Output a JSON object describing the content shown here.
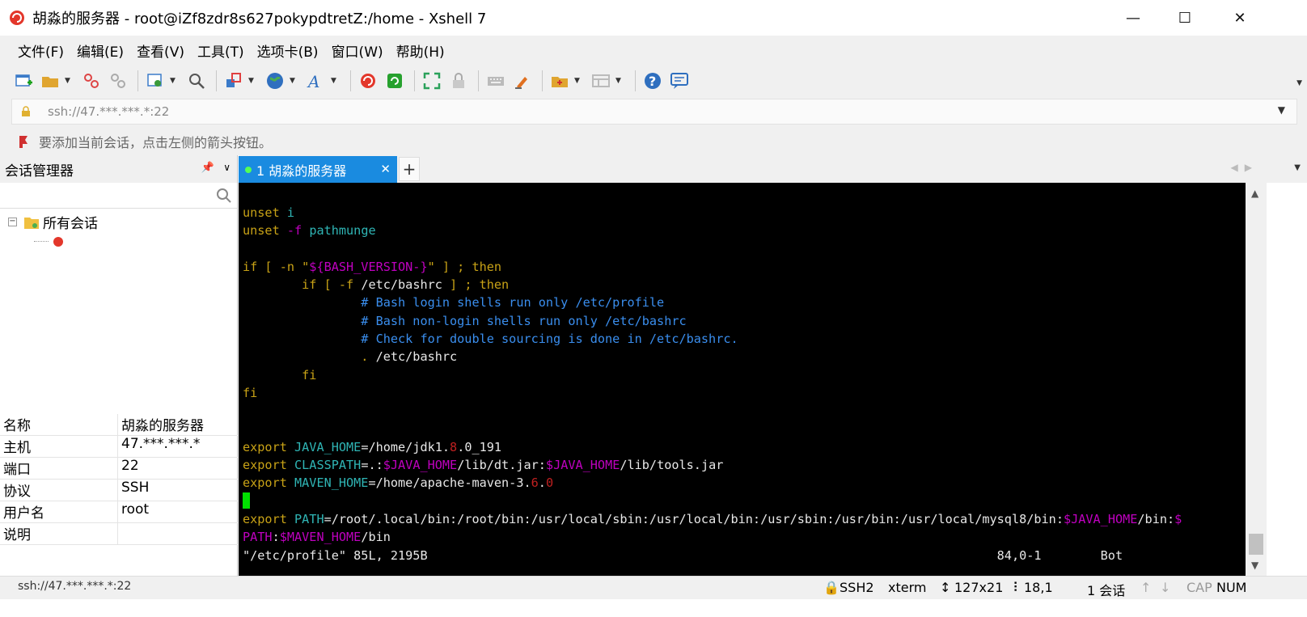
{
  "window": {
    "title": "胡淼的服务器 - root@iZf8zdr8s627pokypdtretZ:/home - Xshell 7",
    "minimize": "—",
    "maximize": "☐",
    "close": "✕"
  },
  "menu": [
    "文件(F)",
    "编辑(E)",
    "查看(V)",
    "工具(T)",
    "选项卡(B)",
    "窗口(W)",
    "帮助(H)"
  ],
  "address": {
    "text": "ssh://47.***.***.*:22"
  },
  "hint": "要添加当前会话，点击左侧的箭头按钮。",
  "session_manager": {
    "title": "会话管理器",
    "search_placeholder": "",
    "tree_root": "所有会话",
    "tree_child": "胡淼的服务器",
    "properties": [
      {
        "key": "名称",
        "value": "胡淼的服务器"
      },
      {
        "key": "主机",
        "value": "47.***.***.*"
      },
      {
        "key": "端口",
        "value": "22"
      },
      {
        "key": "协议",
        "value": "SSH"
      },
      {
        "key": "用户名",
        "value": "root"
      },
      {
        "key": "说明",
        "value": ""
      }
    ]
  },
  "tabs": {
    "active_label": "1 胡淼的服务器",
    "close": "✕",
    "new": "+"
  },
  "terminal": {
    "lines": [
      [
        {
          "t": "unset ",
          "c": "y"
        },
        {
          "t": "i",
          "c": "c"
        }
      ],
      [
        {
          "t": "unset ",
          "c": "y"
        },
        {
          "t": "-f ",
          "c": "m"
        },
        {
          "t": "pathmunge",
          "c": "c"
        }
      ],
      [],
      [
        {
          "t": "if [ -n \"",
          "c": "y"
        },
        {
          "t": "${BASH_VERSION-}",
          "c": "m"
        },
        {
          "t": "\" ] ; then",
          "c": "y"
        }
      ],
      [
        {
          "t": "        if [ -f ",
          "c": "y"
        },
        {
          "t": "/etc/bashrc",
          "c": "w"
        },
        {
          "t": " ] ; then",
          "c": "y"
        }
      ],
      [
        {
          "t": "                # Bash login shells run only /etc/profile",
          "c": "b"
        }
      ],
      [
        {
          "t": "                # Bash non-login shells run only /etc/bashrc",
          "c": "b"
        }
      ],
      [
        {
          "t": "                # Check for double sourcing is done in /etc/bashrc.",
          "c": "b"
        }
      ],
      [
        {
          "t": "                . ",
          "c": "y"
        },
        {
          "t": "/etc/bashrc",
          "c": "w"
        }
      ],
      [
        {
          "t": "        fi",
          "c": "y"
        }
      ],
      [
        {
          "t": "fi",
          "c": "y"
        }
      ],
      [],
      [],
      [
        {
          "t": "export ",
          "c": "y"
        },
        {
          "t": "JAVA_HOME",
          "c": "c"
        },
        {
          "t": "=/home/jdk1.",
          "c": "w"
        },
        {
          "t": "8",
          "c": "r"
        },
        {
          "t": ".0_191",
          "c": "w"
        }
      ],
      [
        {
          "t": "export ",
          "c": "y"
        },
        {
          "t": "CLASSPATH",
          "c": "c"
        },
        {
          "t": "=.:",
          "c": "w"
        },
        {
          "t": "$JAVA_HOME",
          "c": "m"
        },
        {
          "t": "/lib/dt.jar:",
          "c": "w"
        },
        {
          "t": "$JAVA_HOME",
          "c": "m"
        },
        {
          "t": "/lib/tools.jar",
          "c": "w"
        }
      ],
      [
        {
          "t": "export ",
          "c": "y"
        },
        {
          "t": "MAVEN_HOME",
          "c": "c"
        },
        {
          "t": "=/home/apache-maven-3.",
          "c": "w"
        },
        {
          "t": "6",
          "c": "r"
        },
        {
          "t": ".",
          "c": "w"
        },
        {
          "t": "0",
          "c": "r"
        }
      ],
      [
        {
          "t": "CURSOR",
          "c": "cur"
        }
      ],
      [
        {
          "t": "export ",
          "c": "y"
        },
        {
          "t": "PATH",
          "c": "c"
        },
        {
          "t": "=/root/.local/bin:/root/bin:/usr/local/sbin:/usr/local/bin:/usr/sbin:/usr/bin:/usr/local/mysql8/bin:",
          "c": "w"
        },
        {
          "t": "$JAVA_HOME",
          "c": "m"
        },
        {
          "t": "/bin:",
          "c": "w"
        },
        {
          "t": "$",
          "c": "m"
        }
      ],
      [
        {
          "t": "PATH",
          "c": "m"
        },
        {
          "t": ":",
          "c": "w"
        },
        {
          "t": "$MAVEN_HOME",
          "c": "m"
        },
        {
          "t": "/bin",
          "c": "w"
        }
      ],
      [
        {
          "t": "\"/etc/profile\" 85L, 2195B                                                                             84,0-1        Bot",
          "c": "w"
        }
      ]
    ]
  },
  "status": {
    "protocol": "SSH2",
    "term": "xterm",
    "size": "127x21",
    "pos": "18,1",
    "sessions": "1 会话",
    "cap": "CAP",
    "num": "NUM",
    "left_text": "ssh://47.***.***.*:22"
  }
}
